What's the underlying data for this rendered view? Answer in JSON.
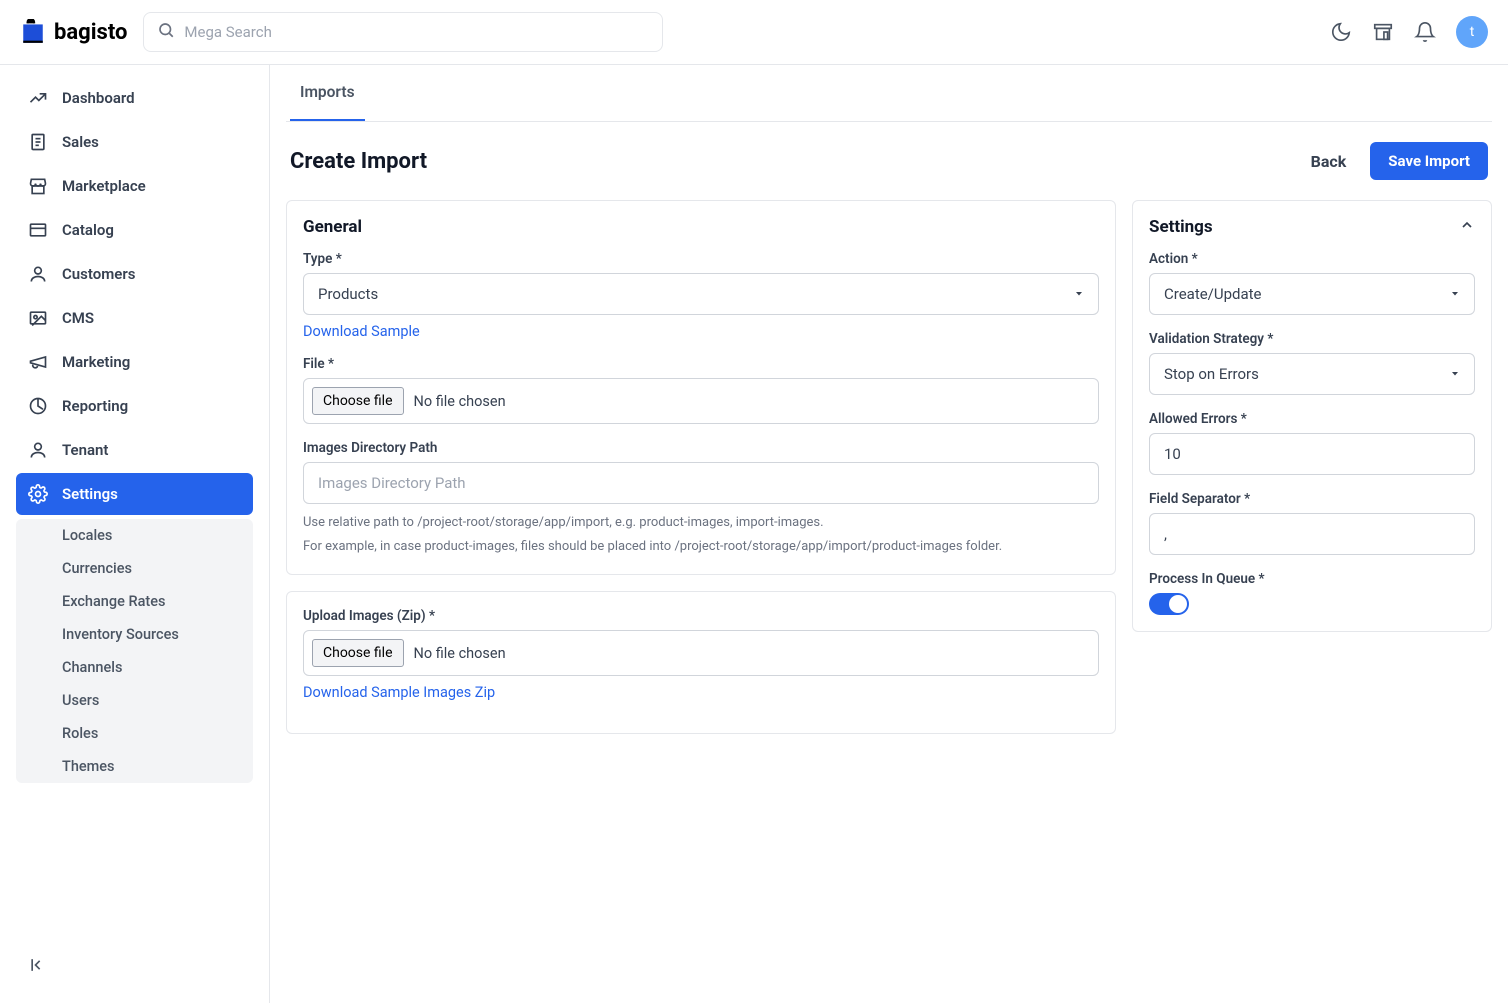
{
  "brand": "bagisto",
  "search": {
    "placeholder": "Mega Search"
  },
  "avatar_initial": "t",
  "sidebar": {
    "items": [
      {
        "label": "Dashboard"
      },
      {
        "label": "Sales"
      },
      {
        "label": "Marketplace"
      },
      {
        "label": "Catalog"
      },
      {
        "label": "Customers"
      },
      {
        "label": "CMS"
      },
      {
        "label": "Marketing"
      },
      {
        "label": "Reporting"
      },
      {
        "label": "Tenant"
      },
      {
        "label": "Settings"
      }
    ],
    "subitems": [
      {
        "label": "Locales"
      },
      {
        "label": "Currencies"
      },
      {
        "label": "Exchange Rates"
      },
      {
        "label": "Inventory Sources"
      },
      {
        "label": "Channels"
      },
      {
        "label": "Users"
      },
      {
        "label": "Roles"
      },
      {
        "label": "Themes"
      }
    ]
  },
  "tabs": {
    "imports": "Imports"
  },
  "page": {
    "title": "Create Import",
    "back": "Back",
    "save": "Save Import"
  },
  "general": {
    "title": "General",
    "type_label": "Type *",
    "type_value": "Products",
    "download_sample": "Download Sample",
    "file_label": "File *",
    "choose_file": "Choose file",
    "no_file": "No file chosen",
    "images_dir_label": "Images Directory Path",
    "images_dir_placeholder": "Images Directory Path",
    "help1": "Use relative path to /project-root/storage/app/import, e.g. product-images, import-images.",
    "help2": "For example, in case product-images, files should be placed into /project-root/storage/app/import/product-images folder."
  },
  "upload": {
    "label": "Upload Images (Zip) *",
    "choose_file": "Choose file",
    "no_file": "No file chosen",
    "download_sample": "Download Sample Images Zip"
  },
  "settings": {
    "title": "Settings",
    "action_label": "Action *",
    "action_value": "Create/Update",
    "validation_label": "Validation Strategy *",
    "validation_value": "Stop on Errors",
    "allowed_errors_label": "Allowed Errors *",
    "allowed_errors_value": "10",
    "field_sep_label": "Field Separator *",
    "field_sep_value": ",",
    "queue_label": "Process In Queue *"
  }
}
